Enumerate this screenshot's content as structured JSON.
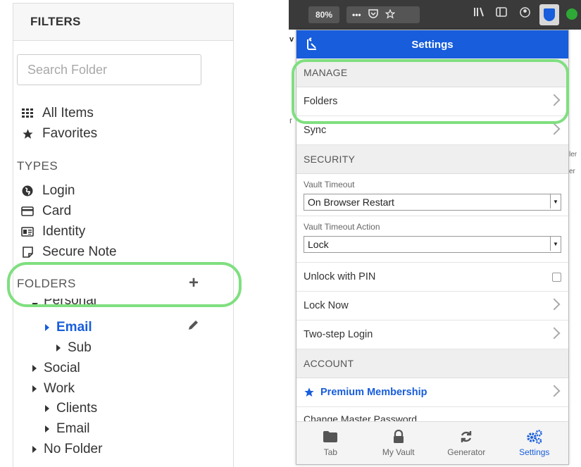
{
  "filters": {
    "title": "FILTERS",
    "search_placeholder": "Search Folder",
    "all_items": "All Items",
    "favorites": "Favorites",
    "types_heading": "TYPES",
    "types": [
      "Login",
      "Card",
      "Identity",
      "Secure Note"
    ],
    "folders_heading": "FOLDERS",
    "add_label": "+",
    "folders": {
      "personal": "Personal",
      "email": "Email",
      "sub": "Sub",
      "social": "Social",
      "work": "Work",
      "clients": "Clients",
      "work_email": "Email",
      "no_folder": "No Folder"
    }
  },
  "browser": {
    "zoom": "80%",
    "more": "•••",
    "accent": "#175ddc",
    "highlight_color": "#7fdf7f"
  },
  "popup": {
    "title": "Settings",
    "manage_heading": "MANAGE",
    "folders_item": "Folders",
    "sync_item": "Sync",
    "security_heading": "SECURITY",
    "vault_timeout_label": "Vault Timeout",
    "vault_timeout_value": "On Browser Restart",
    "vault_timeout_action_label": "Vault Timeout Action",
    "vault_timeout_action_value": "Lock",
    "unlock_pin": "Unlock with PIN",
    "lock_now": "Lock Now",
    "two_step": "Two-step Login",
    "account_heading": "ACCOUNT",
    "premium": "Premium Membership",
    "change_master": "Change Master Password",
    "tabs": [
      "Tab",
      "My Vault",
      "Generator",
      "Settings"
    ]
  },
  "background_fragments": [
    "r",
    "ler",
    "er",
    "v"
  ]
}
